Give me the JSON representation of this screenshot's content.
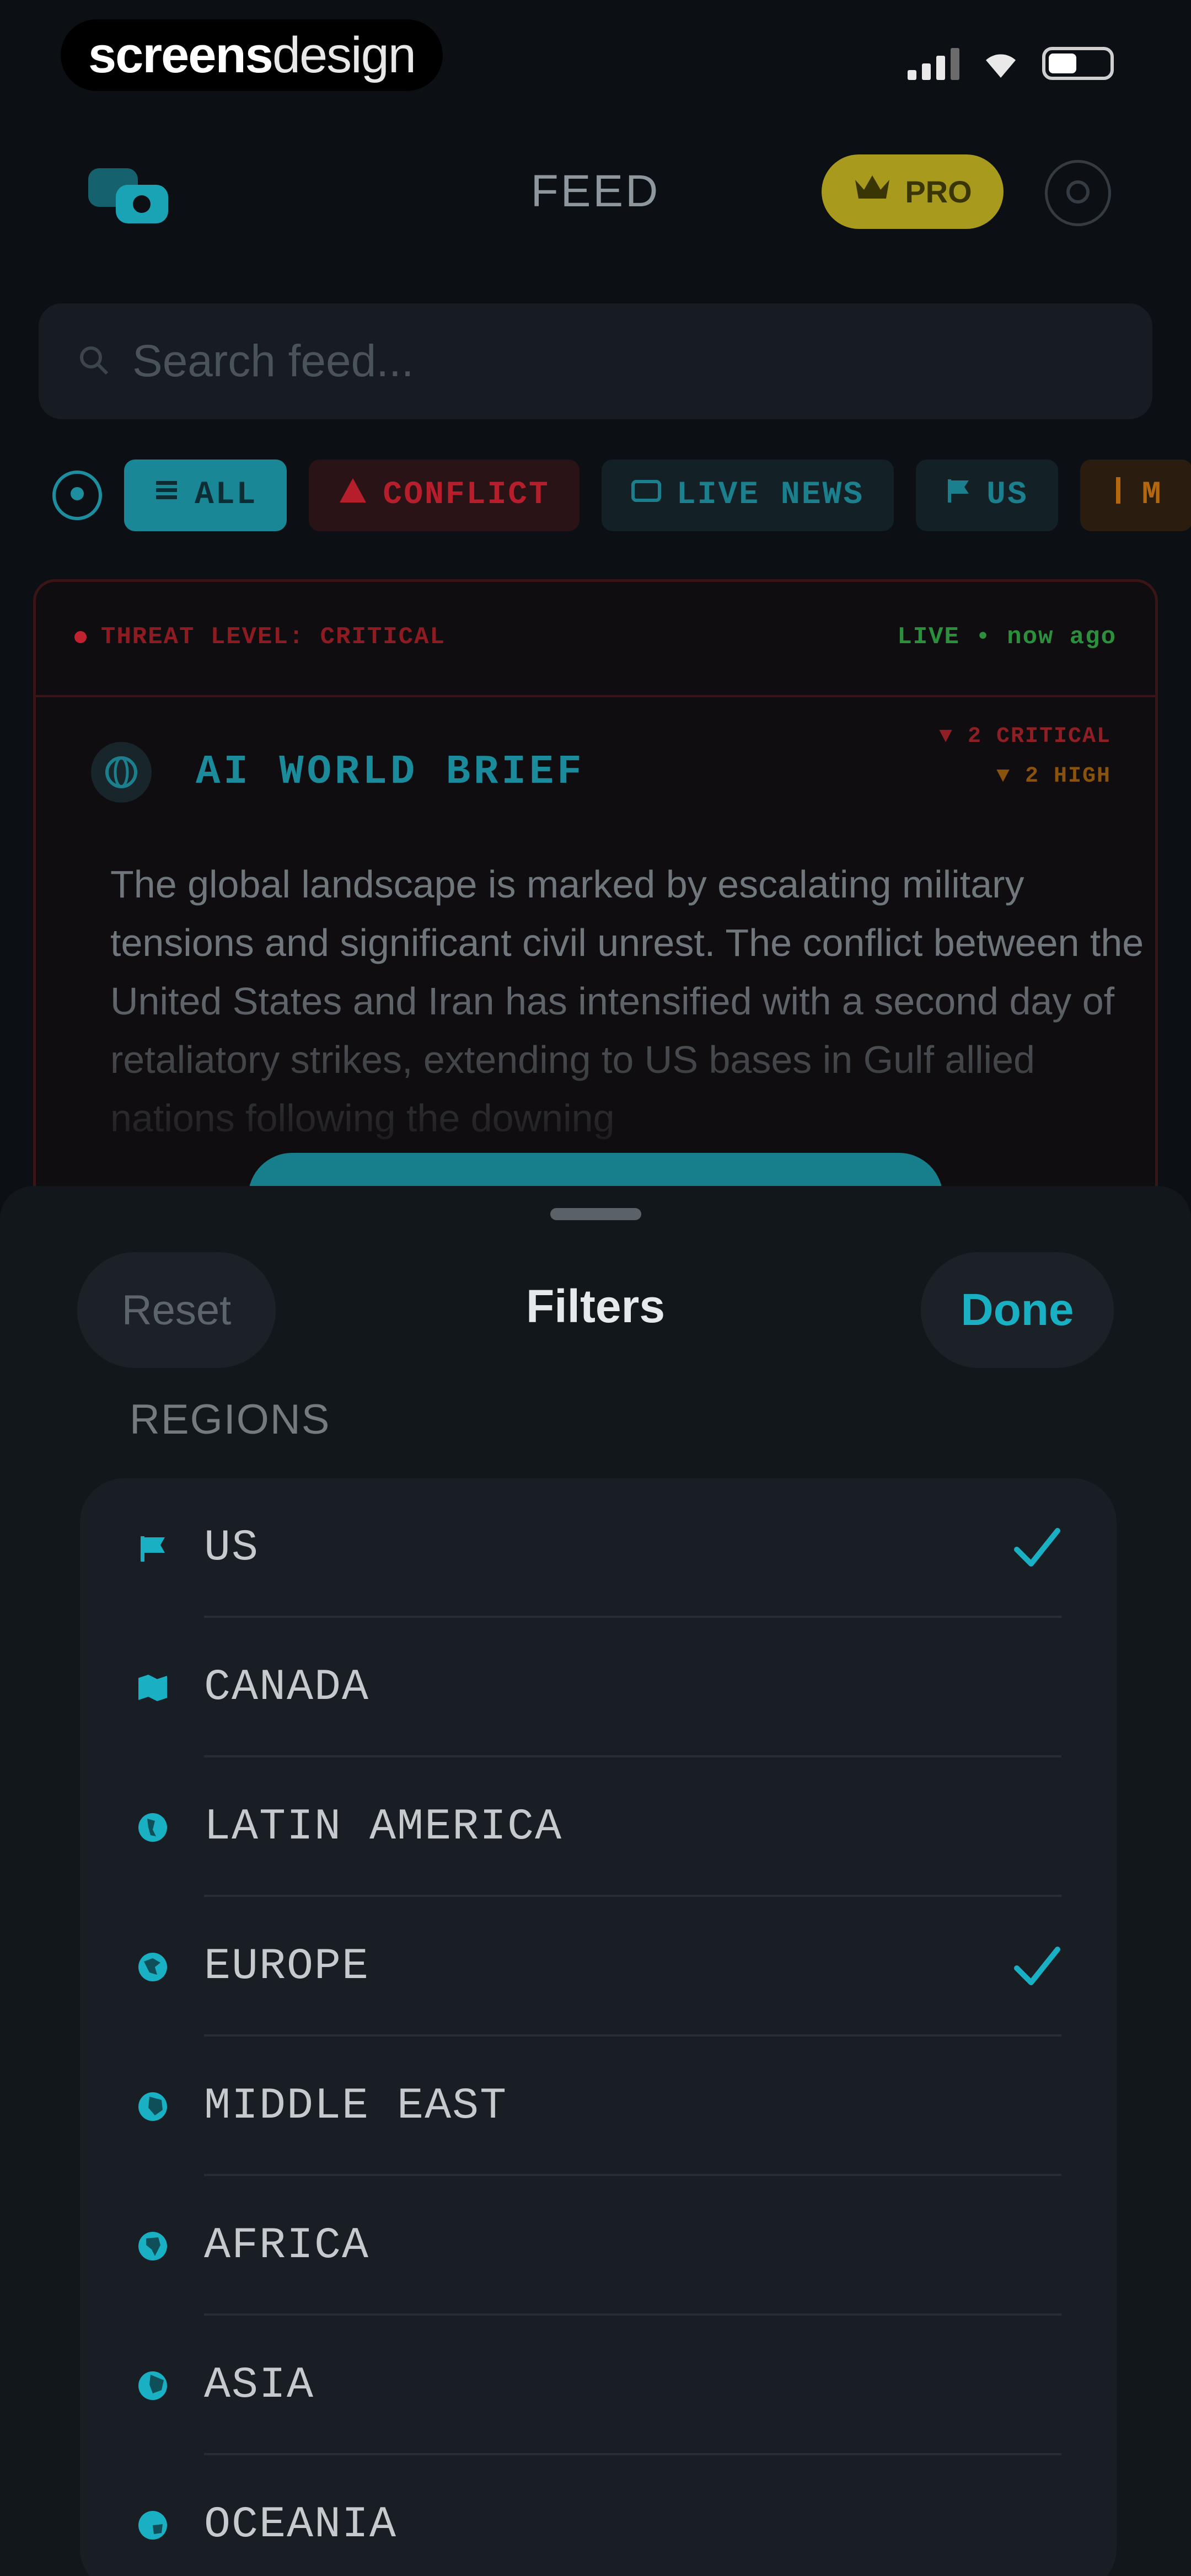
{
  "status_bar": {
    "watermark_bold": "screens",
    "watermark_light": "design"
  },
  "header": {
    "title": "FEED",
    "pro_label": "PRO"
  },
  "search": {
    "placeholder": "Search feed..."
  },
  "chips": [
    {
      "label": "ALL",
      "icon": "list-icon",
      "active": true
    },
    {
      "label": "CONFLICT",
      "icon": "warning-icon",
      "active": false
    },
    {
      "label": "LIVE NEWS",
      "icon": "tv-icon",
      "active": false
    },
    {
      "label": "US",
      "icon": "flag-icon",
      "active": false
    },
    {
      "label": "M",
      "icon": "dollar-icon",
      "active": false
    }
  ],
  "brief": {
    "threat_label": "THREAT LEVEL: CRITICAL",
    "live_label": "LIVE • now ago",
    "title": "AI WORLD BRIEF",
    "critical_label": "▼ 2 CRITICAL",
    "high_label": "▼ 2 HIGH",
    "text": "The global landscape is marked by escalating military tensions and significant civil unrest. The conflict between the United States and Iran has intensified with a second day of retaliatory strikes, extending to US bases in Gulf allied nations following the downing"
  },
  "sheet": {
    "reset_label": "Reset",
    "title": "Filters",
    "done_label": "Done",
    "section_label": "REGIONS",
    "regions": [
      {
        "label": "US",
        "icon": "flag-icon",
        "checked": true
      },
      {
        "label": "CANADA",
        "icon": "map-icon",
        "checked": false
      },
      {
        "label": "LATIN AMERICA",
        "icon": "globe-americas-icon",
        "checked": false
      },
      {
        "label": "EUROPE",
        "icon": "globe-europe-icon",
        "checked": true
      },
      {
        "label": "MIDDLE EAST",
        "icon": "globe-asia-icon",
        "checked": false
      },
      {
        "label": "AFRICA",
        "icon": "globe-africa-icon",
        "checked": false
      },
      {
        "label": "ASIA",
        "icon": "globe-asia-icon",
        "checked": false
      },
      {
        "label": "OCEANIA",
        "icon": "globe-oceania-icon",
        "checked": false
      }
    ]
  },
  "colors": {
    "accent": "#1ab0c4",
    "critical": "#c0232f",
    "pro": "#a79a1d",
    "background": "#0c1014"
  }
}
